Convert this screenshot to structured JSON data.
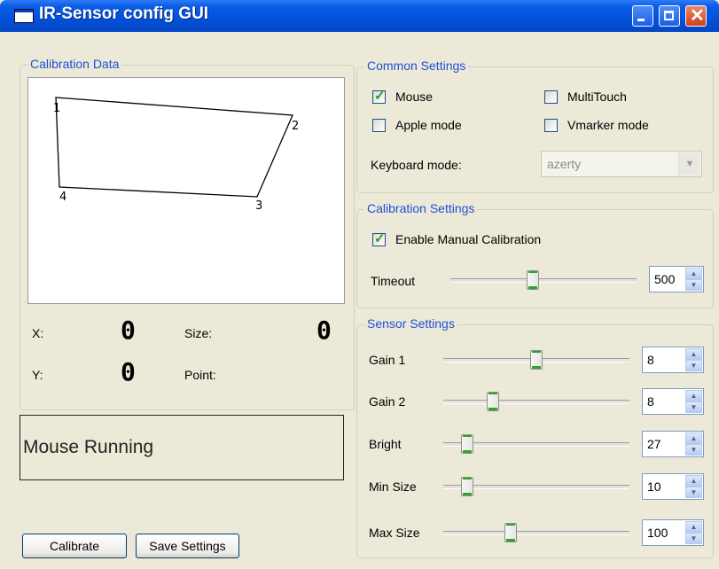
{
  "window": {
    "title": "IR-Sensor config GUI"
  },
  "calibration_data": {
    "title": "Calibration Data",
    "points": [
      {
        "label": "1"
      },
      {
        "label": "2"
      },
      {
        "label": "3"
      },
      {
        "label": "4"
      }
    ],
    "x_label": "X:",
    "x_value": "0",
    "y_label": "Y:",
    "y_value": "0",
    "size_label": "Size:",
    "size_value": "0",
    "point_label": "Point:"
  },
  "status_text": "Mouse Running",
  "buttons": {
    "calibrate": "Calibrate",
    "save_settings": "Save Settings"
  },
  "common_settings": {
    "title": "Common Settings",
    "mouse": {
      "label": "Mouse",
      "checked": true
    },
    "multitouch": {
      "label": "MultiTouch",
      "checked": false
    },
    "apple_mode": {
      "label": "Apple mode",
      "checked": false
    },
    "vmarker_mode": {
      "label": "Vmarker mode",
      "checked": false
    },
    "keyboard_mode_label": "Keyboard mode:",
    "keyboard_mode_value": "azerty"
  },
  "calibration_settings": {
    "title": "Calibration Settings",
    "enable_manual": {
      "label": "Enable Manual Calibration",
      "checked": true
    },
    "timeout_label": "Timeout",
    "timeout_value": "500",
    "timeout_level": 0.44
  },
  "sensor_settings": {
    "title": "Sensor Settings",
    "sliders": [
      {
        "label": "Gain 1",
        "value": "8",
        "level": 0.5
      },
      {
        "label": "Gain 2",
        "value": "8",
        "level": 0.25
      },
      {
        "label": "Bright",
        "value": "27",
        "level": 0.1
      },
      {
        "label": "Min Size",
        "value": "10",
        "level": 0.1
      },
      {
        "label": "Max Size",
        "value": "100",
        "level": 0.35
      }
    ]
  }
}
